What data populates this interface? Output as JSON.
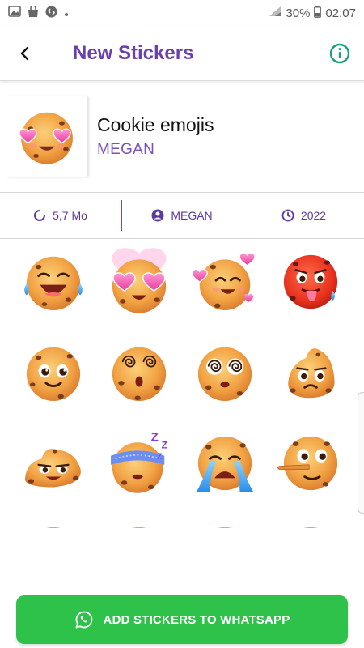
{
  "status_bar": {
    "battery": "30%",
    "time": "02:07",
    "icons": [
      "image-icon",
      "bag-icon",
      "shazam-icon",
      "dot-icon",
      "signal-icon",
      "battery-icon"
    ]
  },
  "app_bar": {
    "title": "New Stickers",
    "back_icon": "back-arrow-icon",
    "info_icon": "info-icon"
  },
  "pack": {
    "name": "Cookie emojis",
    "publisher": "MEGAN"
  },
  "info": {
    "size": "5,7 Mo",
    "author": "MEGAN",
    "year": "2022"
  },
  "stickers": [
    "laughing-tears-cookie",
    "heart-eyes-cookie",
    "hearts-love-cookie",
    "red-tongue-cookie",
    "smiling-cookie",
    "dizzy-eyes-cookie",
    "spiral-eyes-cookie",
    "swirl-hat-cookie",
    "melting-cookie",
    "sleeping-mask-cookie",
    "crying-cookie",
    "lying-nose-cookie"
  ],
  "add_button": {
    "label": "ADD STICKERS TO WHATSAPP",
    "icon": "whatsapp-icon"
  },
  "colors": {
    "accent": "#6a3fb0",
    "add_button": "#2fc24a",
    "info_icon": "#1a9f7a",
    "cookie": "#f2a445"
  }
}
